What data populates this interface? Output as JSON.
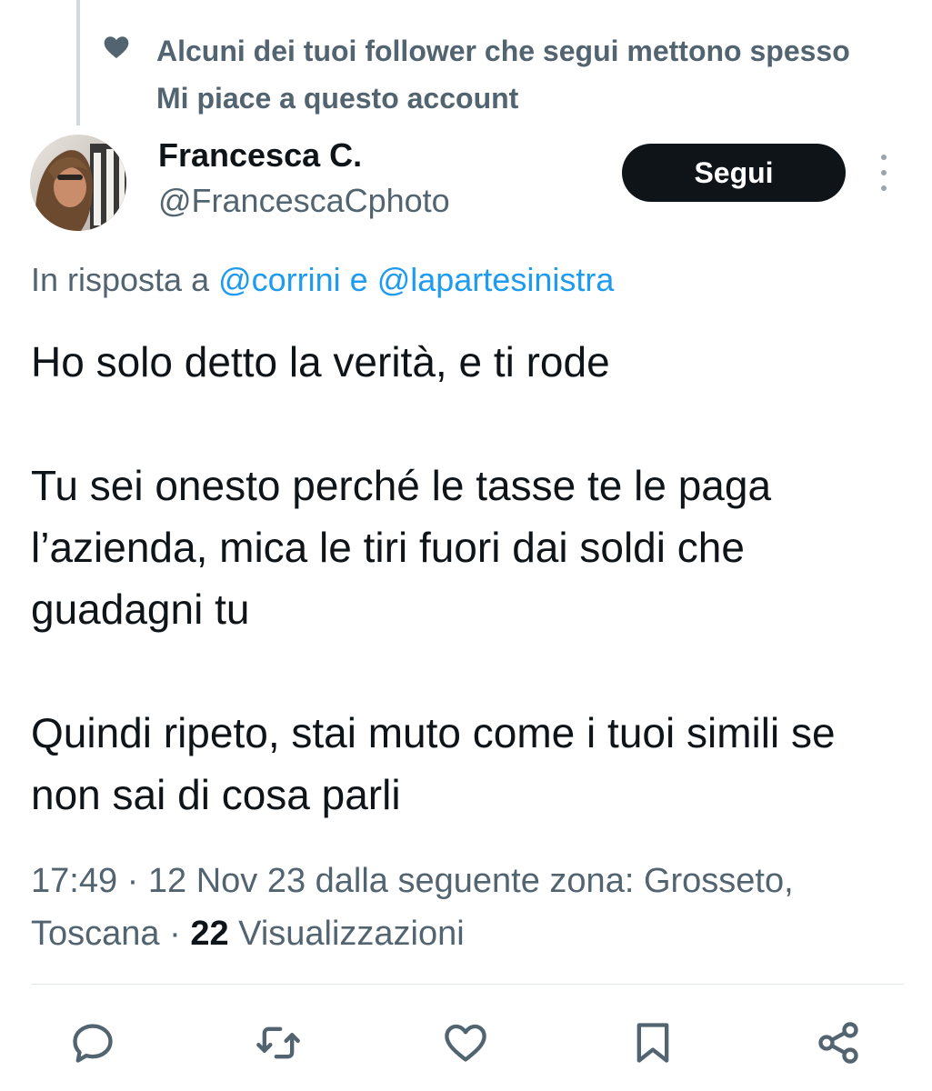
{
  "social_context": {
    "text": "Alcuni dei tuoi follower che segui mettono spesso Mi piace a questo account",
    "icon": "heart-icon"
  },
  "author": {
    "display_name": "Francesca C.",
    "handle": "@FrancescaCphoto",
    "follow_label": "Segui"
  },
  "reply_context": {
    "prefix": "In risposta a ",
    "mention_1": "@corrini",
    "conjunction": " e ",
    "mention_2": "@lapartesinistra"
  },
  "tweet": {
    "paragraphs": [
      "Ho solo detto la verità, e ti rode",
      "Tu sei onesto perché le tasse te le paga l’azienda, mica le tiri fuori dai soldi che guadagni tu",
      "Quindi ripeto, stai muto come i tuoi simili se non sai di cosa parli"
    ]
  },
  "meta": {
    "time": "17:49",
    "separator": " · ",
    "date_location": "12 Nov 23 dalla seguente zona: Grosseto, Toscana",
    "views_count": "22",
    "views_label": " Visualizzazioni"
  },
  "actions": {
    "icons": [
      "reply-icon",
      "retweet-icon",
      "like-icon",
      "bookmark-icon",
      "share-icon"
    ]
  },
  "colors": {
    "text": "#0f1419",
    "secondary": "#536471",
    "link": "#1d9bf0",
    "button_bg": "#0f1419",
    "divider": "#dfe4e8"
  }
}
